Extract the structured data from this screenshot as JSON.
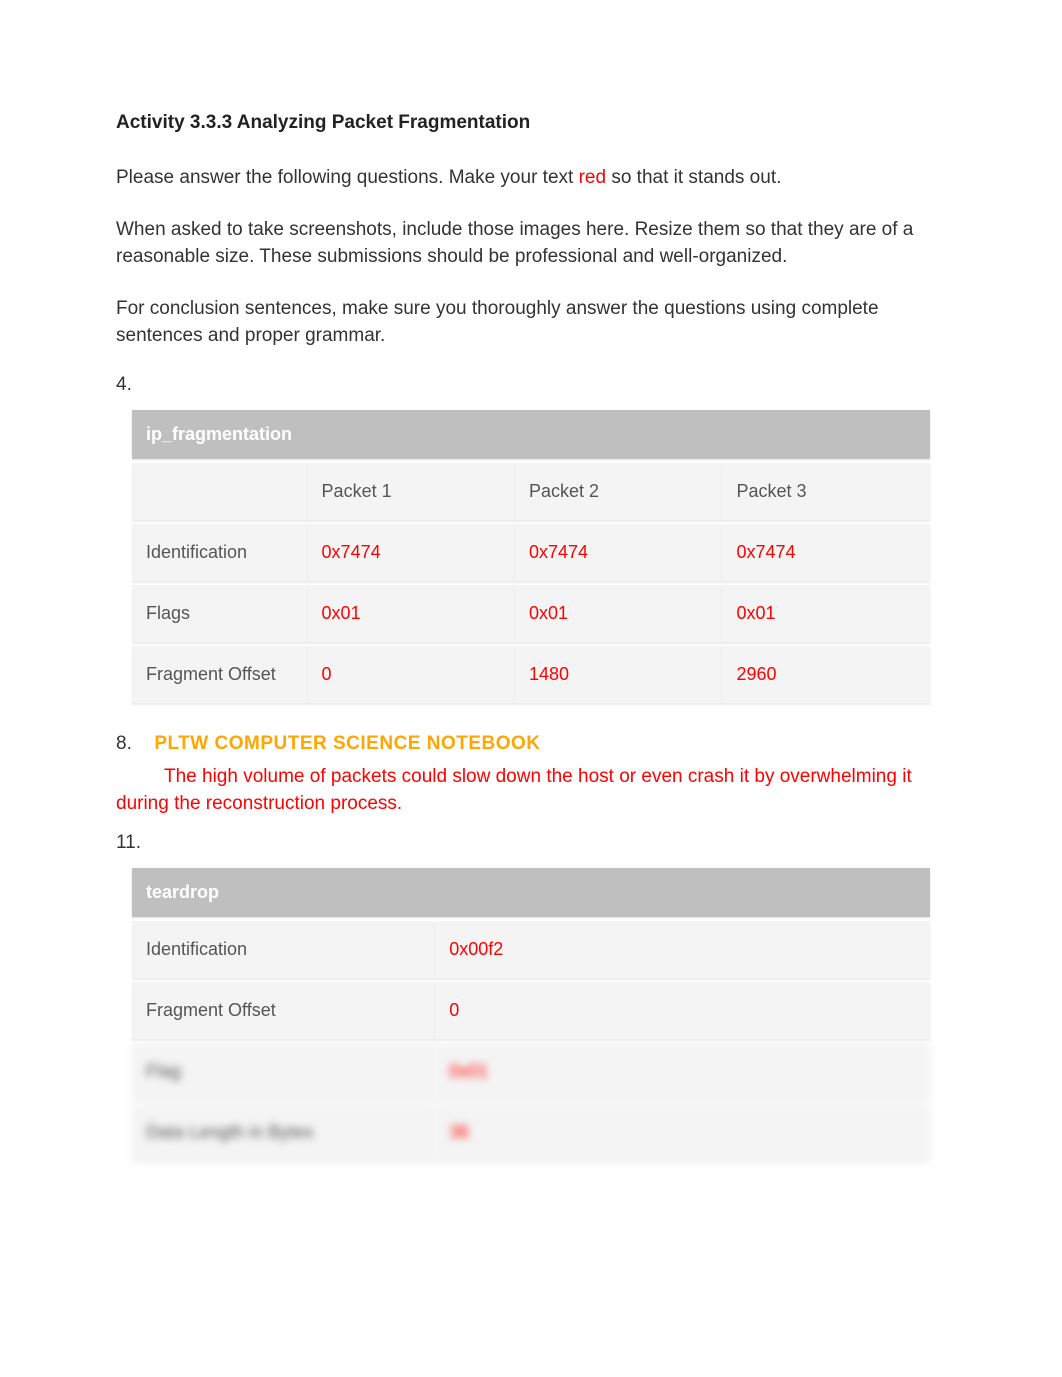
{
  "title": "Activity 3.3.3 Analyzing Packet Fragmentation",
  "intro": {
    "line1_pre": "Please answer the following questions. Make your text ",
    "line1_red": "red",
    "line1_post": " so that it stands out.",
    "line2": "When asked to take screenshots, include those images here. Resize them so that they are of a reasonable size. These submissions should be professional and well-organized.",
    "line3": "For conclusion sentences, make sure you thoroughly answer the questions using complete sentences and proper grammar."
  },
  "q4": {
    "num": "4.",
    "table_title": "ip_fragmentation",
    "headers": [
      "",
      "Packet 1",
      "Packet 2",
      "Packet 3"
    ],
    "rows": [
      {
        "label": "Identification",
        "cells": [
          "0x7474",
          "0x7474",
          "0x7474"
        ]
      },
      {
        "label": "Flags",
        "cells": [
          "0x01",
          "0x01",
          "0x01"
        ]
      },
      {
        "label": "Fragment Offset",
        "cells": [
          "0",
          "1480",
          "2960"
        ]
      }
    ]
  },
  "q8": {
    "num": "8.",
    "watermark": "PLTW COMPUTER SCIENCE NOTEBOOK",
    "answer": "The high volume of packets could slow down the host or even crash it by overwhelming it during the reconstruction process."
  },
  "q11": {
    "num": "11.",
    "table_title": "teardrop",
    "rows": [
      {
        "label": "Identification",
        "value": "0x00f2"
      },
      {
        "label": "Fragment Offset",
        "value": "0"
      },
      {
        "label": "Flag",
        "value": "0x01"
      },
      {
        "label": "Data Length in Bytes",
        "value": "36"
      }
    ]
  }
}
